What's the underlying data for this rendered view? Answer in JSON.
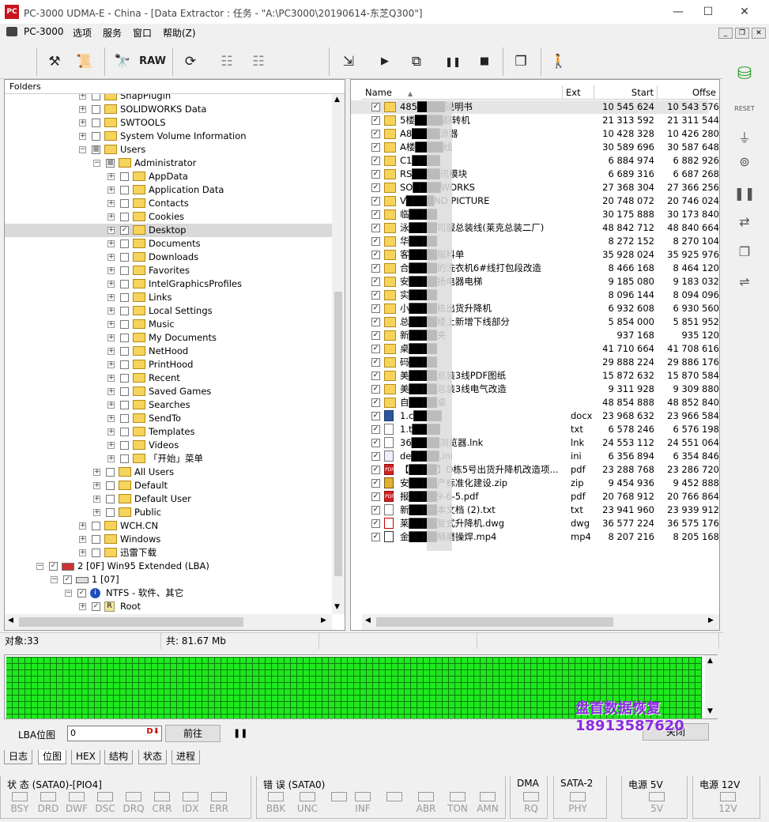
{
  "window": {
    "title": "PC-3000 UDMA-E - China - [Data Extractor : 任务 - \"A:\\PC3000\\20190614-东芝Q300\"]",
    "app_icon_text": "PC",
    "minimize": "—",
    "maximize": "☐",
    "close": "✕"
  },
  "menubar": {
    "items": [
      "PC-3000",
      "选项",
      "服务",
      "窗口",
      "帮助(Z)"
    ]
  },
  "toolbar": {
    "buttons": [
      {
        "name": "tools",
        "glyph": "⚒"
      },
      {
        "name": "script",
        "glyph": "📜"
      },
      {
        "name": "binoculars",
        "glyph": "🔭"
      },
      {
        "name": "raw",
        "glyph": "RAW"
      },
      {
        "name": "open-folder",
        "glyph": "⟳"
      },
      {
        "name": "tree-view",
        "glyph": "☷"
      },
      {
        "name": "tree-view-2",
        "glyph": "☷"
      },
      {
        "name": "export",
        "glyph": "⇲"
      },
      {
        "name": "play",
        "glyph": "▶"
      },
      {
        "name": "network",
        "glyph": "⧉"
      },
      {
        "name": "pause",
        "glyph": "❚❚"
      },
      {
        "name": "stop",
        "glyph": "■"
      },
      {
        "name": "windows",
        "glyph": "❐"
      },
      {
        "name": "exit",
        "glyph": "🚶"
      }
    ]
  },
  "sidepanel": {
    "reset_label": "RESET"
  },
  "tree": {
    "header": "Folders",
    "rows": [
      {
        "depth": 0,
        "exp": "+",
        "check": "",
        "label": "SnapPlugin"
      },
      {
        "depth": 0,
        "exp": "+",
        "check": "",
        "label": "SOLIDWORKS Data"
      },
      {
        "depth": 0,
        "exp": "+",
        "check": "",
        "label": "SWTOOLS"
      },
      {
        "depth": 0,
        "exp": "+",
        "check": "",
        "label": "System Volume Information"
      },
      {
        "depth": 0,
        "exp": "−",
        "check": "■",
        "label": "Users"
      },
      {
        "depth": 1,
        "exp": "−",
        "check": "■",
        "label": "Administrator"
      },
      {
        "depth": 2,
        "exp": "+",
        "check": "",
        "label": "AppData"
      },
      {
        "depth": 2,
        "exp": "+",
        "check": "",
        "label": "Application Data"
      },
      {
        "depth": 2,
        "exp": "+",
        "check": "",
        "label": "Contacts"
      },
      {
        "depth": 2,
        "exp": "+",
        "check": "",
        "label": "Cookies"
      },
      {
        "depth": 2,
        "exp": "+",
        "check": "✓",
        "label": "Desktop",
        "selected": true
      },
      {
        "depth": 2,
        "exp": "+",
        "check": "",
        "label": "Documents"
      },
      {
        "depth": 2,
        "exp": "+",
        "check": "",
        "label": "Downloads"
      },
      {
        "depth": 2,
        "exp": "+",
        "check": "",
        "label": "Favorites"
      },
      {
        "depth": 2,
        "exp": "+",
        "check": "",
        "label": "IntelGraphicsProfiles"
      },
      {
        "depth": 2,
        "exp": "+",
        "check": "",
        "label": "Links"
      },
      {
        "depth": 2,
        "exp": "+",
        "check": "",
        "label": "Local Settings"
      },
      {
        "depth": 2,
        "exp": "+",
        "check": "",
        "label": "Music"
      },
      {
        "depth": 2,
        "exp": "+",
        "check": "",
        "label": "My Documents"
      },
      {
        "depth": 2,
        "exp": "+",
        "check": "",
        "label": "NetHood"
      },
      {
        "depth": 2,
        "exp": "+",
        "check": "",
        "label": "PrintHood"
      },
      {
        "depth": 2,
        "exp": "+",
        "check": "",
        "label": "Recent"
      },
      {
        "depth": 2,
        "exp": "+",
        "check": "",
        "label": "Saved Games"
      },
      {
        "depth": 2,
        "exp": "+",
        "check": "",
        "label": "Searches"
      },
      {
        "depth": 2,
        "exp": "+",
        "check": "",
        "label": "SendTo"
      },
      {
        "depth": 2,
        "exp": "+",
        "check": "",
        "label": "Templates"
      },
      {
        "depth": 2,
        "exp": "+",
        "check": "",
        "label": "Videos"
      },
      {
        "depth": 2,
        "exp": "+",
        "check": "",
        "label": "「开始」菜单"
      },
      {
        "depth": 1,
        "exp": "+",
        "check": "",
        "label": "All Users"
      },
      {
        "depth": 1,
        "exp": "+",
        "check": "",
        "label": "Default"
      },
      {
        "depth": 1,
        "exp": "+",
        "check": "",
        "label": "Default User"
      },
      {
        "depth": 1,
        "exp": "+",
        "check": "",
        "label": "Public"
      },
      {
        "depth": 0,
        "exp": "+",
        "check": "",
        "label": "WCH.CN"
      },
      {
        "depth": 0,
        "exp": "+",
        "check": "",
        "label": "Windows"
      },
      {
        "depth": 0,
        "exp": "+",
        "check": "",
        "label": "迅雷下载"
      },
      {
        "depth": -3,
        "exp": "−",
        "check": "✓",
        "label": "2 [0F] Win95 Extended  (LBA)",
        "icon": "partition"
      },
      {
        "depth": -2,
        "exp": "−",
        "check": "✓",
        "label": "1 [07]",
        "icon": "disk"
      },
      {
        "depth": -1,
        "exp": "−",
        "check": "✓",
        "label": "NTFS - 软件、其它",
        "icon": "info"
      },
      {
        "depth": -1,
        "exp": "+",
        "check": "✓",
        "label": "Root",
        "icon": "root",
        "indent_extra": true
      }
    ]
  },
  "files": {
    "columns": {
      "name": "Name",
      "ext": "Ext",
      "start": "Start",
      "offset": "Offse"
    },
    "rows": [
      {
        "icon": "folder",
        "name": "485████说明书",
        "ext": "",
        "start": "10 545 624",
        "offset": "10 543 576"
      },
      {
        "icon": "folder",
        "name": "5楼████翻转机",
        "ext": "",
        "start": "21 313 592",
        "offset": "21 311 544"
      },
      {
        "icon": "folder",
        "name": "A8████源器",
        "ext": "",
        "start": "10 428 328",
        "offset": "10 426 280"
      },
      {
        "icon": "folder",
        "name": "A楼████线",
        "ext": "",
        "start": "30 589 696",
        "offset": "30 587 648"
      },
      {
        "icon": "folder",
        "name": "C1████",
        "ext": "",
        "start": "6 884 974",
        "offset": "6 882 926"
      },
      {
        "icon": "folder",
        "name": "RS████讯模块",
        "ext": "",
        "start": "6 689 316",
        "offset": "6 687 268"
      },
      {
        "icon": "folder",
        "name": "SO████WORKS",
        "ext": "",
        "start": "27 368 304",
        "offset": "27 366 256"
      },
      {
        "icon": "folder",
        "name": "V████ND PICTURE",
        "ext": "",
        "start": "20 748 072",
        "offset": "20 746 024"
      },
      {
        "icon": "folder",
        "name": "临████",
        "ext": "",
        "start": "30 175 888",
        "offset": "30 173 840"
      },
      {
        "icon": "folder",
        "name": "泳████司服总装线(莱克总装二厂)",
        "ext": "",
        "start": "48 842 712",
        "offset": "48 840 664"
      },
      {
        "icon": "folder",
        "name": "华████",
        "ext": "",
        "start": "8 272 152",
        "offset": "8 270 104"
      },
      {
        "icon": "folder",
        "name": "客████服料单",
        "ext": "",
        "start": "35 928 024",
        "offset": "35 925 976"
      },
      {
        "icon": "folder",
        "name": "合████的洗衣机6#线打包段改造",
        "ext": "",
        "start": "8 466 168",
        "offset": "8 464 120"
      },
      {
        "icon": "folder",
        "name": "安████扬电器电梯",
        "ext": "",
        "start": "9 185 080",
        "offset": "9 183 032"
      },
      {
        "icon": "folder",
        "name": "实████",
        "ext": "",
        "start": "8 096 144",
        "offset": "8 094 096"
      },
      {
        "icon": "folder",
        "name": "小████栋出货升降机",
        "ext": "",
        "start": "6 932 608",
        "offset": "6 930 560"
      },
      {
        "icon": "folder",
        "name": "总████楼上新增下线部分",
        "ext": "",
        "start": "5 854 000",
        "offset": "5 851 952"
      },
      {
        "icon": "folder",
        "name": "新████夹",
        "ext": "",
        "start": "937 168",
        "offset": "935 120"
      },
      {
        "icon": "folder",
        "name": "桌████",
        "ext": "",
        "start": "41 710 664",
        "offset": "41 708 616"
      },
      {
        "icon": "folder",
        "name": "码████",
        "ext": "",
        "start": "29 888 224",
        "offset": "29 886 176"
      },
      {
        "icon": "folder",
        "name": "美████总装3线PDF图纸",
        "ext": "",
        "start": "15 872 632",
        "offset": "15 870 584"
      },
      {
        "icon": "folder",
        "name": "美████总装3线电气改造",
        "ext": "",
        "start": "9 311 928",
        "offset": "9 309 880"
      },
      {
        "icon": "folder",
        "name": "自████桌",
        "ext": "",
        "start": "48 854 888",
        "offset": "48 852 840"
      },
      {
        "icon": "docx",
        "name": "1.c████",
        "ext": "docx",
        "start": "23 968 632",
        "offset": "23 966 584"
      },
      {
        "icon": "txt",
        "name": "1.t████",
        "ext": "txt",
        "start": "6 578 246",
        "offset": "6 576 198"
      },
      {
        "icon": "lnk",
        "name": "36████浏览器.lnk",
        "ext": "lnk",
        "start": "24 553 112",
        "offset": "24 551 064"
      },
      {
        "icon": "ini",
        "name": "de████.ini",
        "ext": "ini",
        "start": "6 356 894",
        "offset": "6 354 846"
      },
      {
        "icon": "pdf",
        "name": "【████】D栋5号出货升降机改造项...",
        "ext": "pdf",
        "start": "23 288 768",
        "offset": "23 286 720"
      },
      {
        "icon": "zip",
        "name": "安████产标准化建设.zip",
        "ext": "zip",
        "start": "9 454 936",
        "offset": "9 452 888"
      },
      {
        "icon": "pdf",
        "name": "报████9-6-5.pdf",
        "ext": "pdf",
        "start": "20 768 912",
        "offset": "20 766 864"
      },
      {
        "icon": "txt",
        "name": "新████本文档 (2).txt",
        "ext": "txt",
        "start": "23 941 960",
        "offset": "23 939 912"
      },
      {
        "icon": "dwg",
        "name": "莱████复式升降机.dwg",
        "ext": "dwg",
        "start": "36 577 224",
        "offset": "36 575 176"
      },
      {
        "icon": "mp4",
        "name": "金████桶磨操焊.mp4",
        "ext": "mp4",
        "start": "8 207 216",
        "offset": "8 205 168"
      }
    ]
  },
  "status": {
    "objects": "对象:33",
    "total": "共:  81.67 Mb"
  },
  "lba": {
    "label": "LBA位图",
    "value": "0",
    "go_button": "前往",
    "pause_glyph": "❚❚",
    "close_button": "关闭"
  },
  "tabs": [
    "日志",
    "位图",
    "HEX",
    "结构",
    "状态",
    "进程"
  ],
  "watermark": {
    "line1": "盘首数据恢复",
    "line2": "18913587620"
  },
  "leds": {
    "groups": [
      {
        "title": "状 态 (SATA0)-[PIO4]",
        "items": [
          "BSY",
          "DRD",
          "DWF",
          "DSC",
          "DRQ",
          "CRR",
          "IDX",
          "ERR"
        ]
      },
      {
        "title": "错 误 (SATA0)",
        "items": [
          "BBK",
          "UNC",
          "",
          "INF",
          "",
          "ABR",
          "TON",
          "AMN"
        ]
      },
      {
        "title": "DMA",
        "items": [
          "RQ"
        ]
      },
      {
        "title": "SATA-2",
        "items": [
          "PHY"
        ]
      },
      {
        "title": "电源 5V",
        "items": [
          "5V"
        ]
      },
      {
        "title": "电源 12V",
        "items": [
          "12V"
        ]
      }
    ]
  },
  "colors": {
    "grid_green": "#1ee81e",
    "folder": "#f6d35a",
    "watermark": "#8b2be2",
    "title_icon": "#c8141e"
  }
}
